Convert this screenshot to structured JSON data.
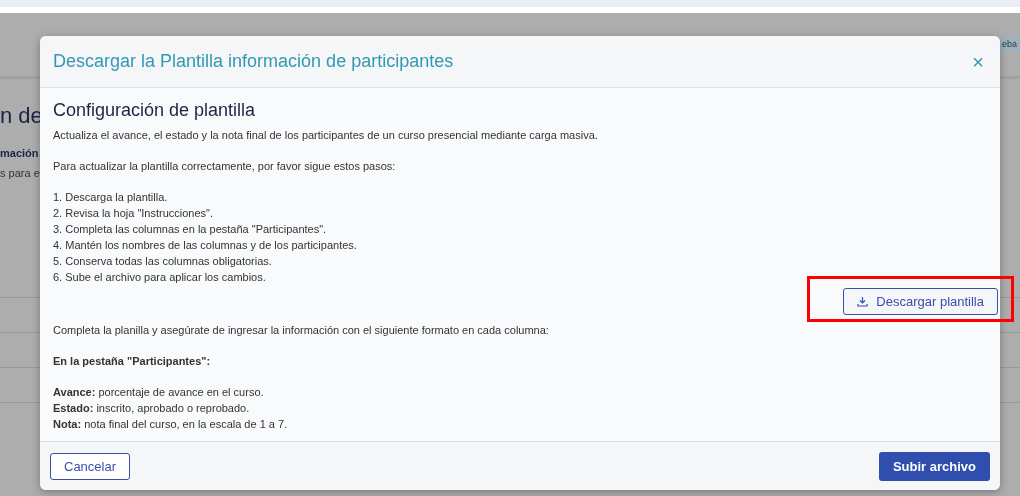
{
  "background": {
    "heading": "n de",
    "subheading": "mación",
    "text": "s para e",
    "badge": "eba"
  },
  "dialog": {
    "title": "Descargar la Plantilla información de participantes",
    "close": "×",
    "section_title": "Configuración de plantilla",
    "intro": "Actualiza el avance, el estado y la nota final de los participantes de un curso presencial mediante carga masiva.",
    "steps_intro": "Para actualizar la plantilla correctamente, por favor sigue estos pasos:",
    "steps": [
      "1. Descarga la plantilla.",
      "2. Revisa la hoja \"Instrucciones\".",
      "3. Completa las columnas en la pestaña \"Participantes\".",
      "4. Mantén los nombres de las columnas y de los participantes.",
      "5. Conserva todas las columnas obligatorias.",
      "6. Sube el archivo para aplicar los cambios."
    ],
    "download_button": {
      "label": "Descargar plantilla",
      "highlighted": true
    },
    "format_intro": "Completa la planilla y asegúrate de ingresar la información con el siguiente formato en cada columna:",
    "tab_heading": "En la pestaña \"Participantes\":",
    "fields": [
      "**Avance:** porcentaje de avance en el curso.",
      "**Estado:** inscrito, aprobado o reprobado.",
      "**Nota:** nota final del curso, en la escala de 1 a 7."
    ],
    "cancel_button": "Cancelar",
    "submit_button": "Subir archivo"
  }
}
